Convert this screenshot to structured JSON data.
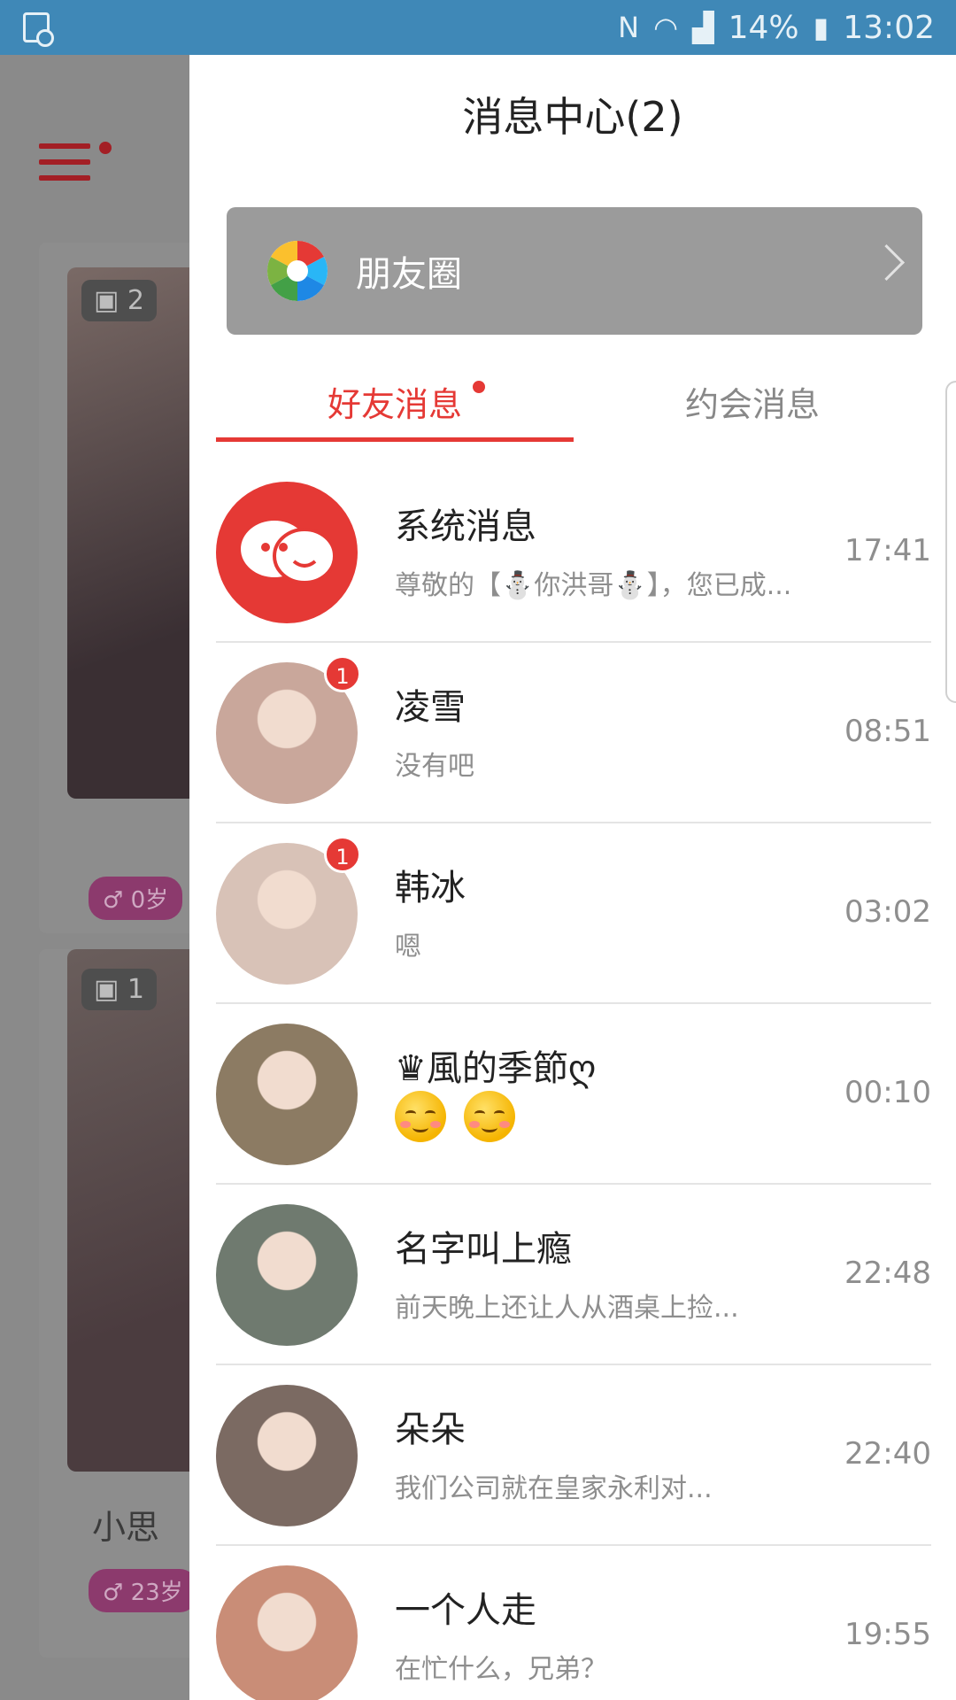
{
  "status_bar": {
    "battery": "14%",
    "time": "13:02",
    "icons": [
      "nfc-icon",
      "wifi-icon",
      "signal-icon",
      "battery-charging-icon"
    ]
  },
  "background": {
    "card1": {
      "photo_count": "2",
      "age": "0岁"
    },
    "card2": {
      "photo_count": "1",
      "name": "小思",
      "age": "23岁"
    }
  },
  "drawer": {
    "title": "消息中心(2)",
    "moments_label": "朋友圈",
    "tabs": [
      {
        "label": "好友消息",
        "active": true,
        "has_dot": true
      },
      {
        "label": "约会消息",
        "active": false,
        "has_dot": false
      }
    ],
    "messages": [
      {
        "name": "系统消息",
        "preview": "尊敬的【⛄你洪哥⛄】，您已成...",
        "time": "17:41",
        "badge": "",
        "avatar": "system-chat-icon",
        "avatar_color": "#e53935"
      },
      {
        "name": "凌雪",
        "preview": "没有吧",
        "time": "08:51",
        "badge": "1",
        "avatar": "user-photo",
        "avatar_color": "#c9a79b"
      },
      {
        "name": "韩冰",
        "preview": "嗯",
        "time": "03:02",
        "badge": "1",
        "avatar": "user-photo",
        "avatar_color": "#d8c2b7"
      },
      {
        "name": "♛風的季節ღ",
        "preview": "",
        "time": "00:10",
        "badge": "",
        "avatar": "user-photo",
        "avatar_color": "#8c7b63",
        "preview_emoji": 2
      },
      {
        "name": "名字叫上瘾",
        "preview": "前天晚上还让人从酒桌上捡...",
        "time": "22:48",
        "badge": "",
        "avatar": "user-photo",
        "avatar_color": "#6f7a6f"
      },
      {
        "name": "朵朵",
        "preview": "我们公司就在皇家永利对...",
        "time": "22:40",
        "badge": "",
        "avatar": "user-photo",
        "avatar_color": "#7b6a62"
      },
      {
        "name": "一个人走",
        "preview": "在忙什么，兄弟？",
        "time": "19:55",
        "badge": "",
        "avatar": "user-photo",
        "avatar_color": "#c98d77"
      }
    ]
  },
  "colors": {
    "accent": "#e53935",
    "statusbar": "#3f88b7"
  }
}
